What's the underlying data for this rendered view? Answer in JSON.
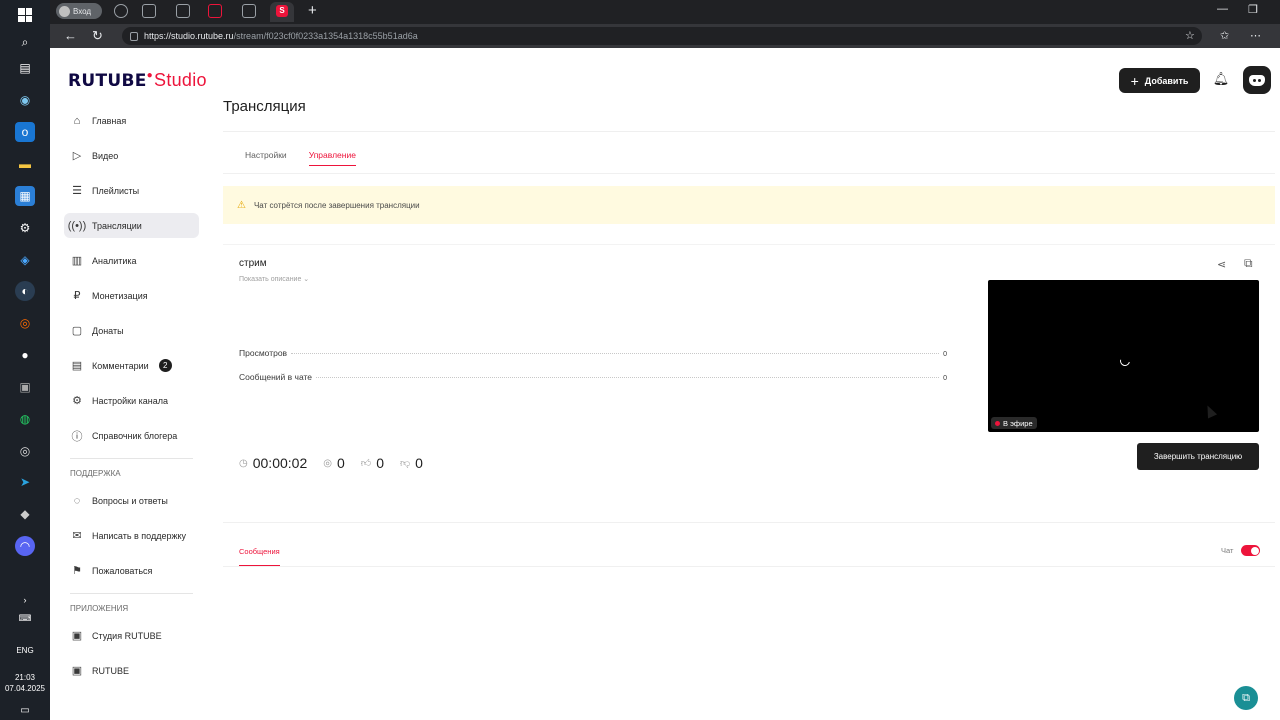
{
  "taskbar": {
    "clock_time": "21:03",
    "clock_date": "07.04.2025",
    "lang": "ENG"
  },
  "browser": {
    "profile_label": "Вход",
    "url_host": "https://studio.rutube.ru",
    "url_path": "/stream/f023cf0f0233a1354a1318c55b51ad6a"
  },
  "header": {
    "logo_text": "RUTUBE",
    "logo_suffix": "Studio",
    "add_label": "Добавить"
  },
  "sidebar": {
    "items": [
      {
        "label": "Главная",
        "icon": "home-icon"
      },
      {
        "label": "Видео",
        "icon": "video-icon"
      },
      {
        "label": "Плейлисты",
        "icon": "playlist-icon"
      },
      {
        "label": "Трансляции",
        "icon": "broadcast-icon"
      },
      {
        "label": "Аналитика",
        "icon": "analytics-icon"
      },
      {
        "label": "Монетизация",
        "icon": "monetization-icon"
      },
      {
        "label": "Донаты",
        "icon": "donations-icon"
      },
      {
        "label": "Комментарии",
        "icon": "comments-icon",
        "badge": "2"
      },
      {
        "label": "Настройки канала",
        "icon": "gear-icon"
      },
      {
        "label": "Справочник блогера",
        "icon": "info-icon"
      }
    ],
    "support_title": "Поддержка",
    "support_items": [
      {
        "label": "Вопросы и ответы"
      },
      {
        "label": "Написать в поддержку"
      },
      {
        "label": "Пожаловаться"
      }
    ],
    "apps_title": "Приложения",
    "apps_items": [
      {
        "label": "Студия RUTUBE"
      },
      {
        "label": "RUTUBE"
      }
    ]
  },
  "main": {
    "title": "Трансляция",
    "tabs": [
      {
        "label": "Настройки"
      },
      {
        "label": "Управление"
      }
    ],
    "notice": "Чат сотрётся после завершения трансляции",
    "stream": {
      "name": "стрим",
      "show_description": "Показать описание ⌄",
      "stats": [
        {
          "label": "Просмотров",
          "value": "0"
        },
        {
          "label": "Сообщений в чате",
          "value": "0"
        }
      ],
      "timer": "00:00:02",
      "viewers": "0",
      "likes": "0",
      "dislikes": "0",
      "live_label": "В эфире",
      "end_button": "Завершить трансляцию"
    },
    "chat": {
      "tab_label": "Сообщения",
      "toggle_label": "Чат"
    }
  },
  "colors": {
    "accent": "#ed143b",
    "dark": "#1f1f1f",
    "notice_bg": "#fffae0"
  }
}
